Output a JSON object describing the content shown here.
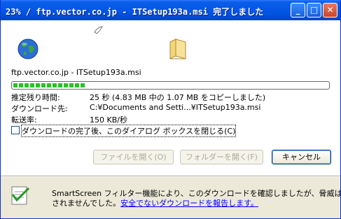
{
  "window": {
    "title": "23% / ftp.vector.co.jp - ITSetup193a.msi 完了しました",
    "minimize_label": "_",
    "maximize_label": "□",
    "close_label": "✕"
  },
  "download": {
    "source": "ftp.vector.co.jp - ITSetup193a.msi",
    "progress_fraction": 0.23,
    "remaining_label": "推定残り時間:",
    "remaining_value": "25 秒 (4.83 MB 中の 1.07 MB をコピーしました)",
    "destination_label": "ダウンロード先:",
    "destination_value": "C:¥Documents and Setti...¥ITSetup193a.msi",
    "rate_label": "転送率:",
    "rate_value": "150 KB/秒",
    "close_on_complete_label": "ダウンロードの完了後、このダイアログ ボックスを閉じる(C)",
    "close_on_complete_checked": false
  },
  "buttons": {
    "open_file": "ファイルを開く(O)",
    "open_folder": "フォルダーを開く(F)",
    "cancel": "キャンセル"
  },
  "smartscreen": {
    "message": "SmartScreen フィルター機能により、このダウンロードを確認しましたが、脅威は報告",
    "message_line2": "されませんでした。",
    "link_text": "安全でないダウンロードを報告します。"
  },
  "icons": {
    "globe": "globe-icon",
    "folder": "folder-icon",
    "paper": "flying-paper-icon",
    "shield": "smartscreen-shield-icon"
  },
  "colors": {
    "titlebar": "#0155e3",
    "progress_fill": "#28c228",
    "link": "#0000ff"
  }
}
